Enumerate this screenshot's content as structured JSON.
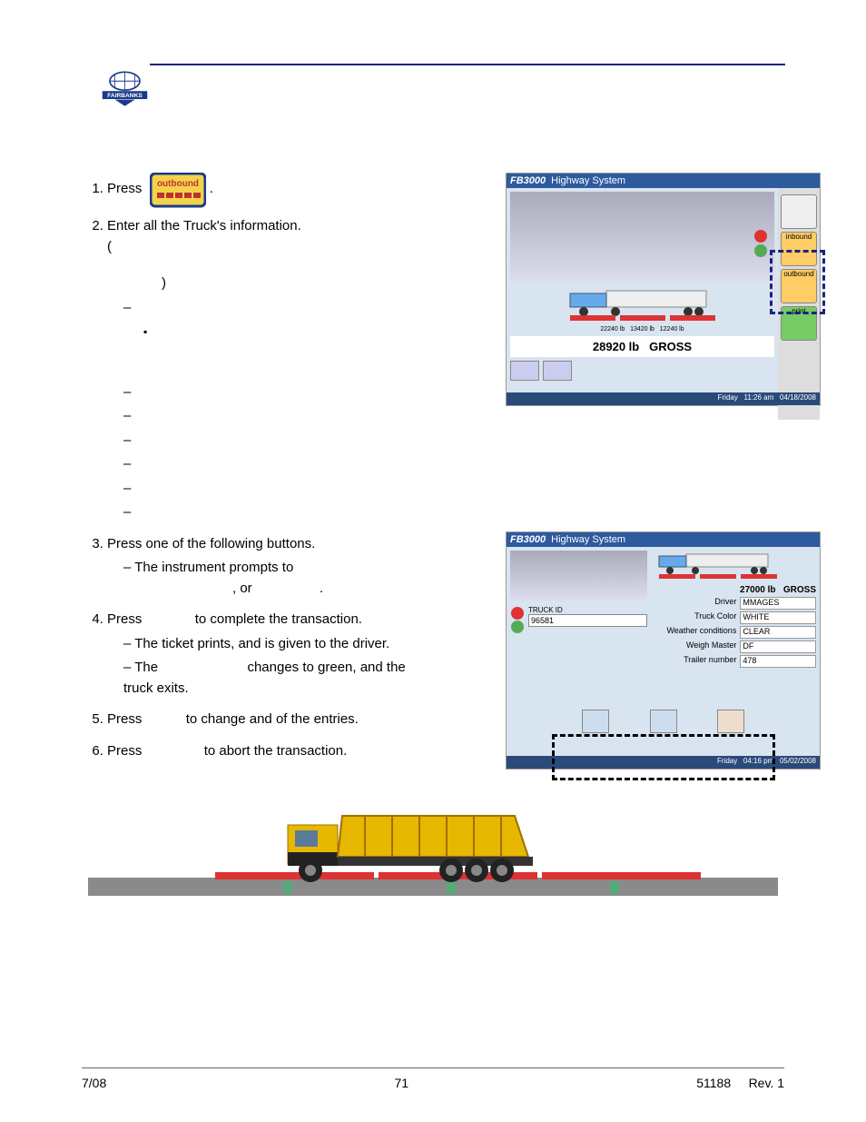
{
  "header": {
    "brand": "FAIRBANKS"
  },
  "buttons": {
    "outbound": "outbound"
  },
  "steps": {
    "s1": {
      "pre": "Press",
      "post": "."
    },
    "s2": {
      "line1": "Enter all the Truck's information.",
      "paren_open": "(",
      "paren_close": ")"
    },
    "s3": {
      "text": "Press one of the following buttons.",
      "sub1_pre": "The instrument prompts to",
      "sub1_mid": ", or",
      "sub1_post": "."
    },
    "s4": {
      "pre": "Press",
      "post": "to complete the transaction.",
      "sub1": "The ticket prints, and is given to the driver.",
      "sub2a": "The",
      "sub2b": "changes to green, and the truck exits."
    },
    "s5": {
      "pre": "Press",
      "post": "to change and of the entries."
    },
    "s6": {
      "pre": "Press",
      "post": "to abort the transaction."
    }
  },
  "screenshot1": {
    "brand": "FB3000",
    "title": "Highway System",
    "scale1": "22240 lb",
    "scale2": "13420 lb",
    "scale3": "12240 lb",
    "weight": "28920 lb",
    "weight_label": "GROSS",
    "btn_inbound": "inbound",
    "btn_outbound": "outbound",
    "btn_print": "print",
    "day": "Friday",
    "time": "11:26 am",
    "date": "04/18/2008"
  },
  "screenshot2": {
    "brand": "FB3000",
    "title": "Highway System",
    "weight": "27000 lb",
    "weight_label": "GROSS",
    "truck_id_label": "TRUCK ID",
    "truck_id": "96581",
    "driver_label": "Driver",
    "driver": "MMAGES",
    "truck_color_label": "Truck Color",
    "truck_color": "WHITE",
    "weather_label": "Weather conditions",
    "weather": "CLEAR",
    "weigh_master_label": "Weigh Master",
    "weigh_master": "DF",
    "trailer_label": "Trailer number",
    "trailer": "478",
    "day": "Friday",
    "time": "04:16 pm",
    "date": "05/02/2008"
  },
  "footer": {
    "left": "7/08",
    "center": "71",
    "right": "51188     Rev. 1"
  }
}
